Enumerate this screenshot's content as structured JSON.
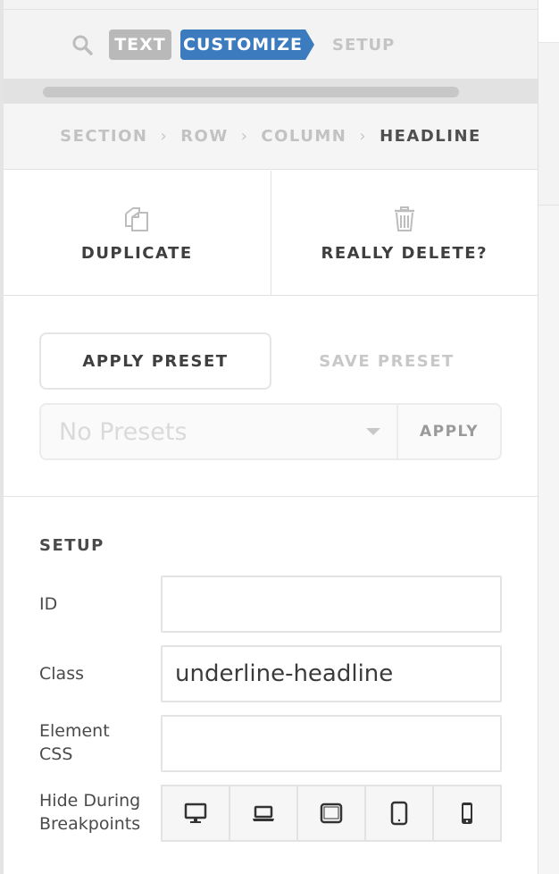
{
  "nav": {
    "tab_text": "TEXT",
    "tab_customize": "CUSTOMIZE",
    "tab_setup": "SETUP",
    "accent_color": "#3c7bbd",
    "search_icon": "search-icon"
  },
  "breadcrumb": [
    "SECTION",
    "ROW",
    "COLUMN",
    "HEADLINE"
  ],
  "actions": {
    "duplicate_label": "DUPLICATE",
    "delete_label": "REALLY DELETE?",
    "duplicate_icon": "duplicate-icon",
    "delete_icon": "trash-icon"
  },
  "presets": {
    "apply_preset_label": "APPLY PRESET",
    "save_preset_label": "SAVE PRESET",
    "select_placeholder": "No Presets",
    "apply_label": "APPLY"
  },
  "setup": {
    "heading": "SETUP",
    "id_label": "ID",
    "id_value": "",
    "class_label": "Class",
    "class_value": "underline-headline",
    "css_label_line1": "Element",
    "css_label_line2": "CSS",
    "css_value": "",
    "hide_label_line1": "Hide During",
    "hide_label_line2": "Breakpoints",
    "breakpoint_icons": [
      "desktop-icon",
      "laptop-icon",
      "tablet-landscape-icon",
      "tablet-portrait-icon",
      "phone-icon"
    ]
  }
}
